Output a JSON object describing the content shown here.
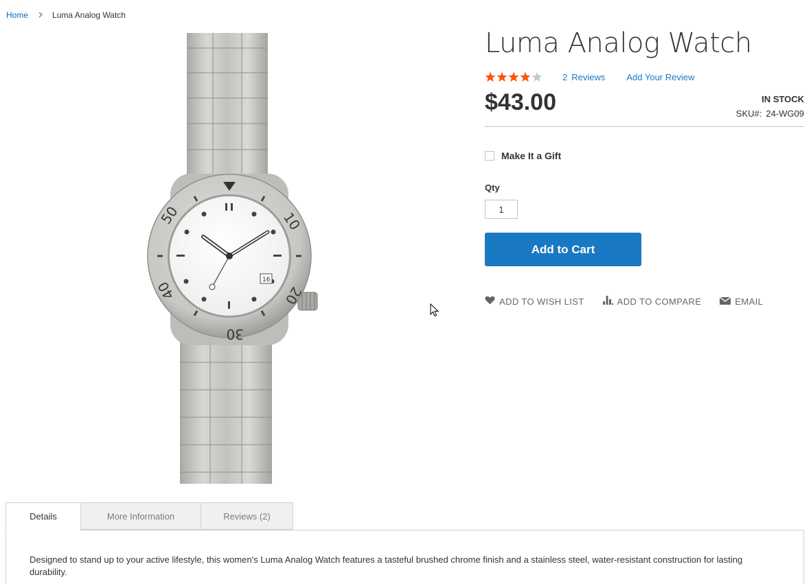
{
  "breadcrumb": {
    "items": [
      {
        "label": "Home"
      },
      {
        "label": "Luma Analog Watch"
      }
    ]
  },
  "product": {
    "title": "Luma Analog Watch",
    "rating_percent": 80,
    "star_color": "#ff5501",
    "reviews_count": "2",
    "reviews_label": "Reviews",
    "add_review_label": "Add Your Review",
    "price": "$43.00",
    "stock_status": "IN STOCK",
    "sku_label": "SKU#:",
    "sku_value": "24-WG09",
    "gift_label": "Make It a Gift",
    "qty_label": "Qty",
    "qty_value": "1",
    "add_to_cart_label": "Add to Cart",
    "accent_color": "#1979c3",
    "watch_dial_numbers": [
      "50",
      "10",
      "40",
      "20",
      "30"
    ],
    "watch_date": "16"
  },
  "actions": {
    "wish_list": "ADD TO WISH LIST",
    "compare": "ADD TO COMPARE",
    "email": "EMAIL"
  },
  "tabs": [
    {
      "label": "Details",
      "active": true
    },
    {
      "label": "More Information",
      "active": false
    },
    {
      "label": "Reviews (2)",
      "active": false
    }
  ],
  "details": {
    "description": "Designed to stand up to your active lifestyle, this women's Luma Analog Watch features a tasteful brushed chrome finish and a stainless steel, water-resistant construction for lasting durability."
  }
}
